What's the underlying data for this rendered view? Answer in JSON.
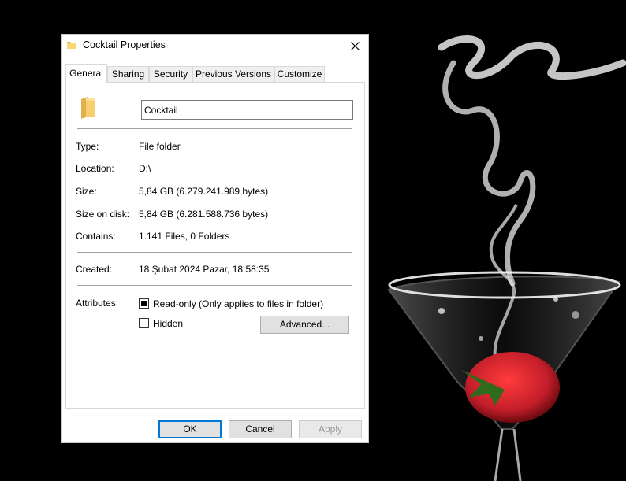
{
  "window": {
    "title": "Cocktail Properties",
    "close_icon": "close-icon",
    "title_icon": "folder-icon"
  },
  "tabs": [
    {
      "label": "General",
      "active": true
    },
    {
      "label": "Sharing",
      "active": false
    },
    {
      "label": "Security",
      "active": false
    },
    {
      "label": "Previous Versions",
      "active": false
    },
    {
      "label": "Customize",
      "active": false
    }
  ],
  "general": {
    "folder_name": "Cocktail",
    "type": {
      "label": "Type:",
      "value": "File folder"
    },
    "location": {
      "label": "Location:",
      "value": "D:\\"
    },
    "size": {
      "label": "Size:",
      "value": "5,84 GB (6.279.241.989 bytes)"
    },
    "size_on_disk": {
      "label": "Size on disk:",
      "value": "5,84 GB (6.281.588.736 bytes)"
    },
    "contains": {
      "label": "Contains:",
      "value": "1.141 Files, 0 Folders"
    },
    "created": {
      "label": "Created:",
      "value": "18 Şubat 2024 Pazar, 18:58:35"
    },
    "attributes": {
      "label": "Attributes:",
      "read_only": {
        "label": "Read-only (Only applies to files in folder)",
        "state": "indeterminate"
      },
      "hidden": {
        "label": "Hidden",
        "state": "unchecked"
      },
      "advanced_label": "Advanced..."
    }
  },
  "buttons": {
    "ok": "OK",
    "cancel": "Cancel",
    "apply": "Apply"
  },
  "colors": {
    "accent": "#0078d7",
    "folder_yellow": "#f3cb62",
    "background": "#000000",
    "strawberry": "#c41e2a"
  }
}
